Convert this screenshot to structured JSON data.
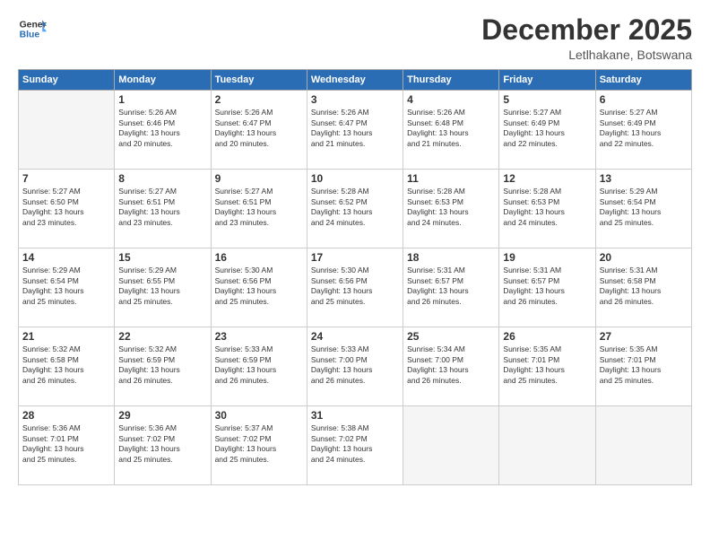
{
  "logo": {
    "line1": "General",
    "line2": "Blue"
  },
  "title": "December 2025",
  "subtitle": "Letlhakane, Botswana",
  "days_of_week": [
    "Sunday",
    "Monday",
    "Tuesday",
    "Wednesday",
    "Thursday",
    "Friday",
    "Saturday"
  ],
  "weeks": [
    [
      {
        "day": "",
        "info": ""
      },
      {
        "day": "1",
        "info": "Sunrise: 5:26 AM\nSunset: 6:46 PM\nDaylight: 13 hours\nand 20 minutes."
      },
      {
        "day": "2",
        "info": "Sunrise: 5:26 AM\nSunset: 6:47 PM\nDaylight: 13 hours\nand 20 minutes."
      },
      {
        "day": "3",
        "info": "Sunrise: 5:26 AM\nSunset: 6:47 PM\nDaylight: 13 hours\nand 21 minutes."
      },
      {
        "day": "4",
        "info": "Sunrise: 5:26 AM\nSunset: 6:48 PM\nDaylight: 13 hours\nand 21 minutes."
      },
      {
        "day": "5",
        "info": "Sunrise: 5:27 AM\nSunset: 6:49 PM\nDaylight: 13 hours\nand 22 minutes."
      },
      {
        "day": "6",
        "info": "Sunrise: 5:27 AM\nSunset: 6:49 PM\nDaylight: 13 hours\nand 22 minutes."
      }
    ],
    [
      {
        "day": "7",
        "info": "Sunrise: 5:27 AM\nSunset: 6:50 PM\nDaylight: 13 hours\nand 23 minutes."
      },
      {
        "day": "8",
        "info": "Sunrise: 5:27 AM\nSunset: 6:51 PM\nDaylight: 13 hours\nand 23 minutes."
      },
      {
        "day": "9",
        "info": "Sunrise: 5:27 AM\nSunset: 6:51 PM\nDaylight: 13 hours\nand 23 minutes."
      },
      {
        "day": "10",
        "info": "Sunrise: 5:28 AM\nSunset: 6:52 PM\nDaylight: 13 hours\nand 24 minutes."
      },
      {
        "day": "11",
        "info": "Sunrise: 5:28 AM\nSunset: 6:53 PM\nDaylight: 13 hours\nand 24 minutes."
      },
      {
        "day": "12",
        "info": "Sunrise: 5:28 AM\nSunset: 6:53 PM\nDaylight: 13 hours\nand 24 minutes."
      },
      {
        "day": "13",
        "info": "Sunrise: 5:29 AM\nSunset: 6:54 PM\nDaylight: 13 hours\nand 25 minutes."
      }
    ],
    [
      {
        "day": "14",
        "info": "Sunrise: 5:29 AM\nSunset: 6:54 PM\nDaylight: 13 hours\nand 25 minutes."
      },
      {
        "day": "15",
        "info": "Sunrise: 5:29 AM\nSunset: 6:55 PM\nDaylight: 13 hours\nand 25 minutes."
      },
      {
        "day": "16",
        "info": "Sunrise: 5:30 AM\nSunset: 6:56 PM\nDaylight: 13 hours\nand 25 minutes."
      },
      {
        "day": "17",
        "info": "Sunrise: 5:30 AM\nSunset: 6:56 PM\nDaylight: 13 hours\nand 25 minutes."
      },
      {
        "day": "18",
        "info": "Sunrise: 5:31 AM\nSunset: 6:57 PM\nDaylight: 13 hours\nand 26 minutes."
      },
      {
        "day": "19",
        "info": "Sunrise: 5:31 AM\nSunset: 6:57 PM\nDaylight: 13 hours\nand 26 minutes."
      },
      {
        "day": "20",
        "info": "Sunrise: 5:31 AM\nSunset: 6:58 PM\nDaylight: 13 hours\nand 26 minutes."
      }
    ],
    [
      {
        "day": "21",
        "info": "Sunrise: 5:32 AM\nSunset: 6:58 PM\nDaylight: 13 hours\nand 26 minutes."
      },
      {
        "day": "22",
        "info": "Sunrise: 5:32 AM\nSunset: 6:59 PM\nDaylight: 13 hours\nand 26 minutes."
      },
      {
        "day": "23",
        "info": "Sunrise: 5:33 AM\nSunset: 6:59 PM\nDaylight: 13 hours\nand 26 minutes."
      },
      {
        "day": "24",
        "info": "Sunrise: 5:33 AM\nSunset: 7:00 PM\nDaylight: 13 hours\nand 26 minutes."
      },
      {
        "day": "25",
        "info": "Sunrise: 5:34 AM\nSunset: 7:00 PM\nDaylight: 13 hours\nand 26 minutes."
      },
      {
        "day": "26",
        "info": "Sunrise: 5:35 AM\nSunset: 7:01 PM\nDaylight: 13 hours\nand 25 minutes."
      },
      {
        "day": "27",
        "info": "Sunrise: 5:35 AM\nSunset: 7:01 PM\nDaylight: 13 hours\nand 25 minutes."
      }
    ],
    [
      {
        "day": "28",
        "info": "Sunrise: 5:36 AM\nSunset: 7:01 PM\nDaylight: 13 hours\nand 25 minutes."
      },
      {
        "day": "29",
        "info": "Sunrise: 5:36 AM\nSunset: 7:02 PM\nDaylight: 13 hours\nand 25 minutes."
      },
      {
        "day": "30",
        "info": "Sunrise: 5:37 AM\nSunset: 7:02 PM\nDaylight: 13 hours\nand 25 minutes."
      },
      {
        "day": "31",
        "info": "Sunrise: 5:38 AM\nSunset: 7:02 PM\nDaylight: 13 hours\nand 24 minutes."
      },
      {
        "day": "",
        "info": ""
      },
      {
        "day": "",
        "info": ""
      },
      {
        "day": "",
        "info": ""
      }
    ]
  ]
}
